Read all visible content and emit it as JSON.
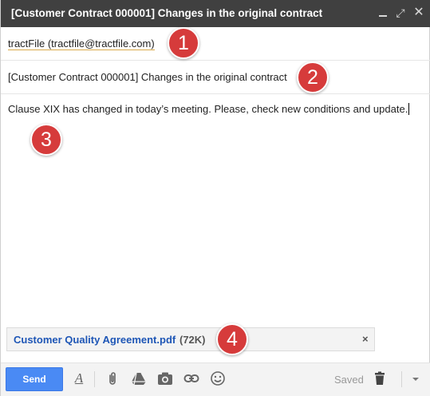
{
  "window": {
    "title": "[Customer Contract 000001] Changes in the original contract",
    "minimize_glyph": "",
    "expand_glyph": "⤢",
    "close_glyph": "✕"
  },
  "compose": {
    "to": "tractFile (tractfile@tractfile.com)",
    "subject": "[Customer Contract 000001] Changes in the original contract",
    "body": "Clause XIX has changed in today’s meeting. Please, check new conditions and update."
  },
  "attachment": {
    "name": "Customer Quality Agreement.pdf",
    "size": "(72K)",
    "remove_glyph": "×"
  },
  "callouts": [
    "1",
    "2",
    "3",
    "4"
  ],
  "toolbar": {
    "send_label": "Send",
    "format_glyph": "A",
    "saved_label": "Saved",
    "icons": [
      "format-text-icon",
      "attach-icon",
      "drive-icon",
      "photo-icon",
      "link-icon",
      "emoji-icon",
      "trash-icon",
      "more-options-icon"
    ]
  },
  "colors": {
    "titlebar": "#404040",
    "send_button": "#4a8af4",
    "attachment_link": "#1e56b6",
    "callout": "#d63b3b"
  }
}
